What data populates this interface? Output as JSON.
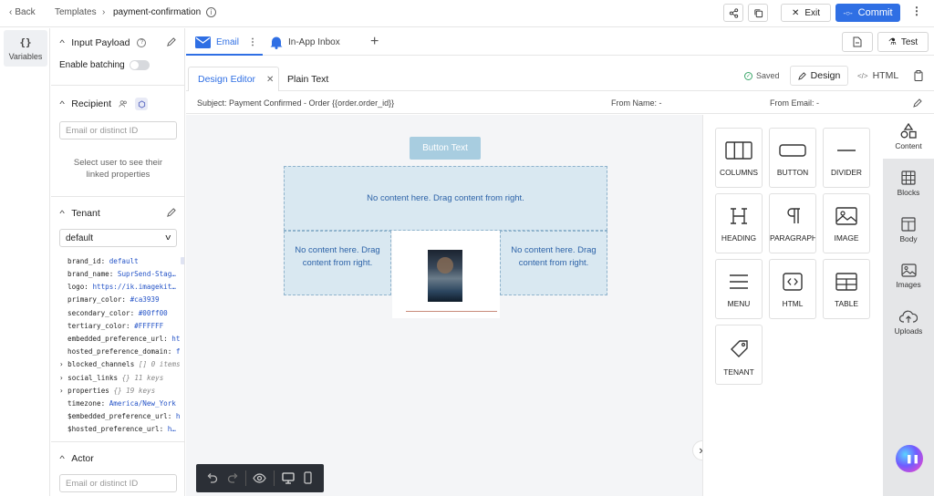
{
  "topbar": {
    "back": "Back",
    "breadcrumb": [
      "Templates",
      "payment-confirmation"
    ],
    "exit": "Exit",
    "commit": "Commit"
  },
  "left_rail": {
    "variables_label": "Variables",
    "variables_glyph": "{}"
  },
  "panel": {
    "input_payload": "Input Payload",
    "enable_batching": "Enable batching",
    "recipient": "Recipient",
    "recipient_placeholder": "Email or distinct ID",
    "recipient_hint": "Select user to see their linked properties",
    "tenant": "Tenant",
    "tenant_selected": "default",
    "tenant_props": [
      {
        "key": "brand_id: ",
        "value": "default"
      },
      {
        "key": "brand_name: ",
        "value": "SuprSend-Stag…"
      },
      {
        "key": "logo: ",
        "value": "https://ik.imagekit…"
      },
      {
        "key": "primary_color: ",
        "value": "#ca3939"
      },
      {
        "key": "secondary_color: ",
        "value": "#00ff00"
      },
      {
        "key": "tertiary_color: ",
        "value": "#FFFFFF"
      },
      {
        "key": "embedded_preference_url: ",
        "value": "ht"
      },
      {
        "key": "hosted_preference_domain: ",
        "value": "f"
      }
    ],
    "tenant_tree": [
      {
        "key": "blocked_channels",
        "meta": "[] 0 items"
      },
      {
        "key": "social_links",
        "meta": "{} 11 keys"
      },
      {
        "key": "properties",
        "meta": "{} 19 keys"
      }
    ],
    "tenant_props2": [
      {
        "key": "timezone: ",
        "value": "America/New_York"
      },
      {
        "key": "$embedded_preference_url: ",
        "value": "h"
      },
      {
        "key": "$hosted_preference_url: ",
        "value": "h…"
      }
    ],
    "actor": "Actor",
    "actor_placeholder": "Email or distinct ID"
  },
  "channels": {
    "email": "Email",
    "inapp": "In-App Inbox",
    "test": "Test"
  },
  "editor": {
    "design_editor": "Design Editor",
    "plain_text": "Plain Text",
    "saved": "Saved",
    "design": "Design",
    "html": "HTML",
    "subject": "Subject: Payment Confirmed - Order {{order.order_id}}",
    "from_name": "From Name: -",
    "from_email": "From Email: -"
  },
  "canvas": {
    "button_text": "Button Text",
    "drop_full": "No content here. Drag content from right.",
    "drop_left": "No content here. Drag content from right.",
    "drop_right": "No content here. Drag content from right."
  },
  "tiles": [
    "COLUMNS",
    "BUTTON",
    "DIVIDER",
    "HEADING",
    "PARAGRAPH",
    "IMAGE",
    "MENU",
    "HTML",
    "TABLE",
    "TENANT"
  ],
  "right_tabs": [
    "Content",
    "Blocks",
    "Body",
    "Images",
    "Uploads"
  ],
  "colors": {
    "accent": "#2f6fe4",
    "dropzone": "#d9e8f1",
    "button": "#a8cde0"
  }
}
